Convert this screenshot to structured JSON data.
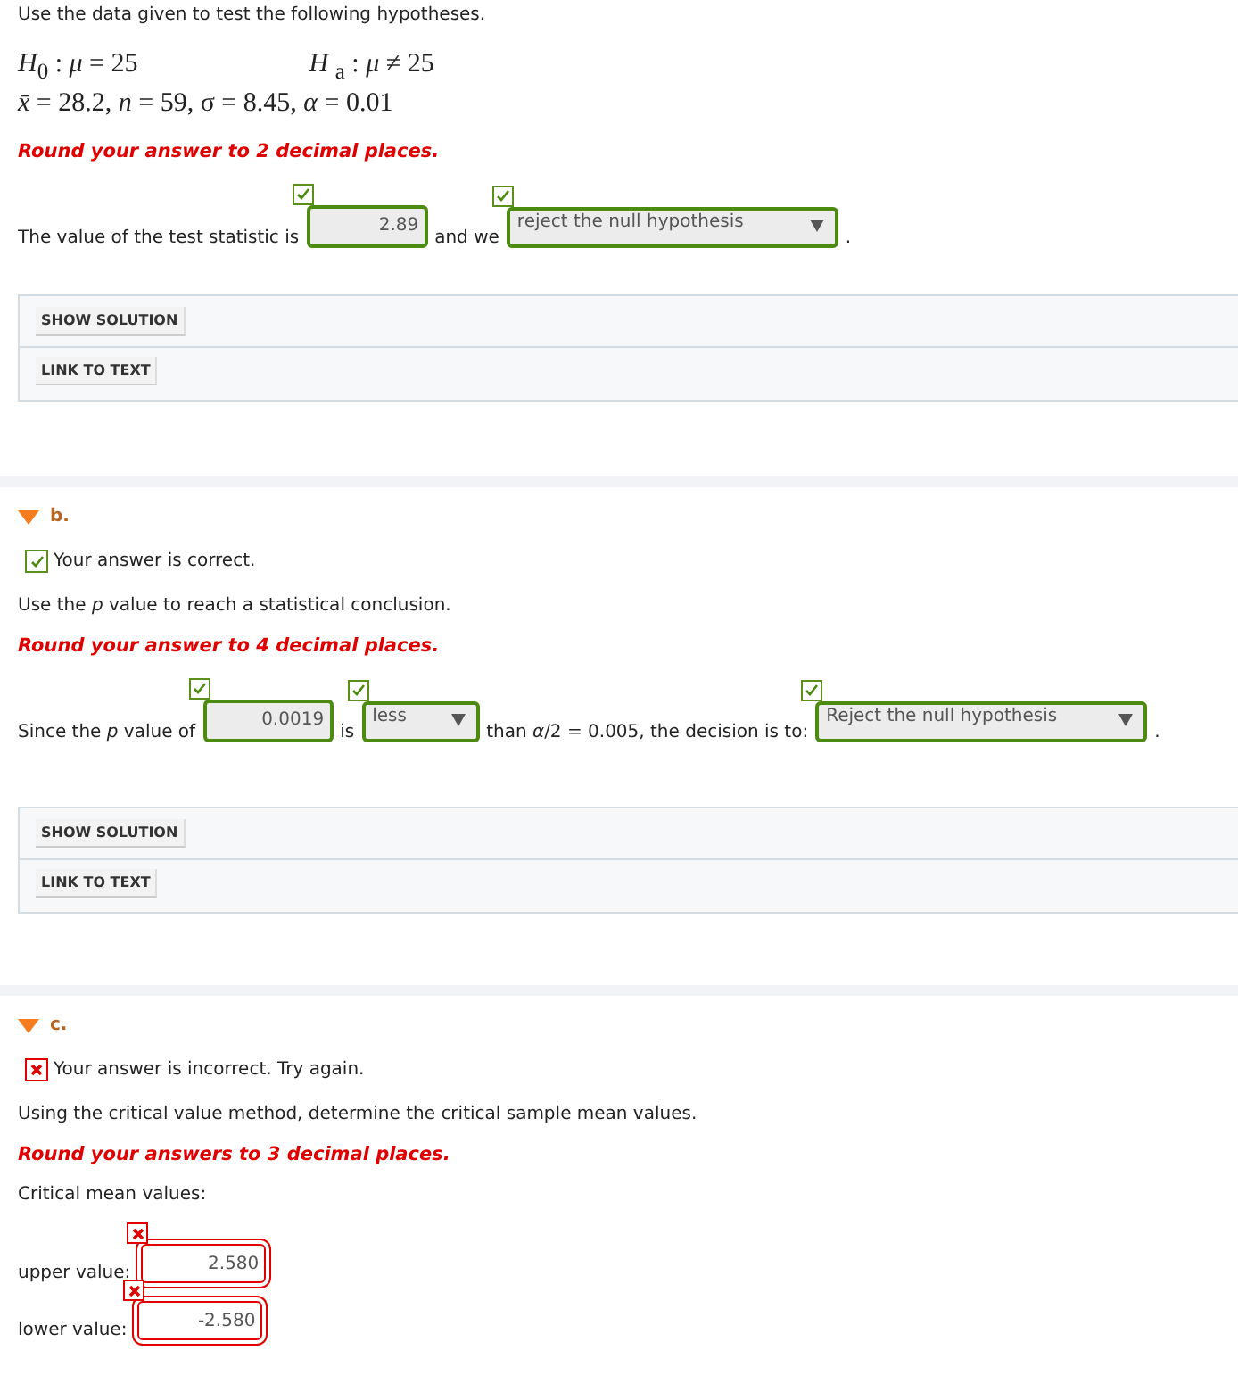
{
  "intro": "Use the data given to test the following hypotheses.",
  "hypotheses": {
    "null": "*H*$_{0}$ : *μ* = 25",
    "alternative": "*H* $_{a}$ : *μ* ≠ 25",
    "given": "*x̄* = 28.2, *n* = 59, σ = 8.45, *α* = 0.01"
  },
  "parts": [
    {
      "rounding": "Round your answer to 2 decimal places.",
      "sentence": [
        {
          "kind": "text",
          "text": "The value of the test statistic is"
        },
        {
          "kind": "input",
          "value": "2.89",
          "correct": true
        },
        {
          "kind": "text",
          "text": "and we"
        },
        {
          "kind": "select",
          "value": "reject the null hypothesis",
          "correct": true
        },
        {
          "kind": "text",
          "text": "."
        }
      ],
      "buttons": [
        "SHOW SOLUTION",
        "LINK TO TEXT"
      ]
    },
    {
      "label": "b.",
      "expanded": true,
      "status": {
        "correct": true,
        "text": "Your answer is correct."
      },
      "prompt": "Use the *p* value to reach a statistical conclusion.",
      "rounding": "Round your answer to 4 decimal places.",
      "sentence": [
        {
          "kind": "text",
          "text": "Since the *p* value of"
        },
        {
          "kind": "input",
          "value": "0.0019",
          "correct": true
        },
        {
          "kind": "text",
          "text": "is"
        },
        {
          "kind": "select",
          "value": "less",
          "correct": true
        },
        {
          "kind": "text",
          "text": "than *α*/2 = 0.005, the decision is to:"
        },
        {
          "kind": "select",
          "value": "Reject the null hypothesis",
          "correct": true
        },
        {
          "kind": "text",
          "text": "."
        }
      ],
      "buttons": [
        "SHOW SOLUTION",
        "LINK TO TEXT"
      ]
    },
    {
      "label": "c.",
      "expanded": true,
      "status": {
        "correct": false,
        "text": "Your answer is incorrect.  Try again."
      },
      "prompt": "Using the critical value method, determine the critical sample mean values.",
      "rounding": "Round your answers to 3 decimal places.",
      "subheading": "Critical mean values:",
      "fields": [
        {
          "label": "upper value:",
          "value": "2.580",
          "correct": false
        },
        {
          "label": "lower value:",
          "value": "-2.580",
          "correct": false
        }
      ]
    }
  ]
}
